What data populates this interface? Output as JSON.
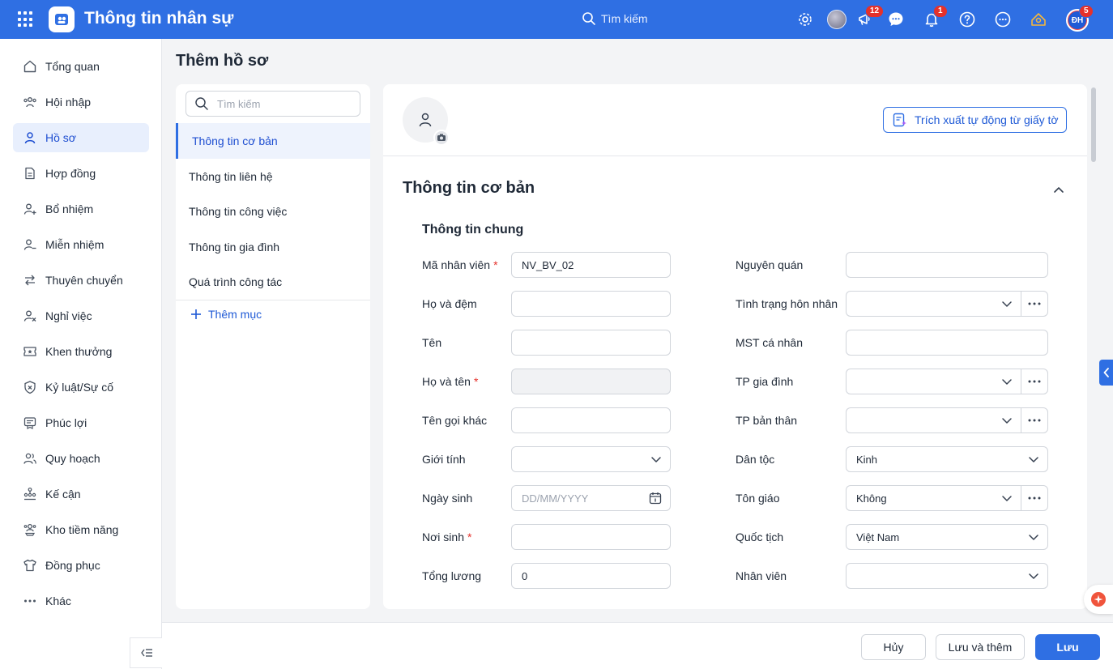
{
  "header": {
    "app_title": "Thông tin nhân sự",
    "search_label": "Tìm kiếm",
    "announcements_badge": "12",
    "notifications_badge": "1",
    "user_initials": "ĐH",
    "user_badge": "5"
  },
  "sidebar": {
    "items": [
      {
        "label": "Tổng quan",
        "icon": "home-icon"
      },
      {
        "label": "Hội nhập",
        "icon": "people-icon"
      },
      {
        "label": "Hồ sơ",
        "icon": "user-icon"
      },
      {
        "label": "Hợp đồng",
        "icon": "document-icon"
      },
      {
        "label": "Bổ nhiệm",
        "icon": "user-plus-icon"
      },
      {
        "label": "Miễn nhiệm",
        "icon": "user-minus-icon"
      },
      {
        "label": "Thuyên chuyển",
        "icon": "transfer-icon"
      },
      {
        "label": "Nghỉ việc",
        "icon": "user-x-icon"
      },
      {
        "label": "Khen thưởng",
        "icon": "ticket-star-icon"
      },
      {
        "label": "Kỷ luật/Sự cố",
        "icon": "shield-x-icon"
      },
      {
        "label": "Phúc lợi",
        "icon": "benefit-icon"
      },
      {
        "label": "Quy hoạch",
        "icon": "users-icon"
      },
      {
        "label": "Kế cận",
        "icon": "hierarchy-icon"
      },
      {
        "label": "Kho tiềm năng",
        "icon": "talent-pool-icon"
      },
      {
        "label": "Đồng phục",
        "icon": "shirt-icon"
      },
      {
        "label": "Khác",
        "icon": "more-icon"
      }
    ],
    "active_index": 2
  },
  "page": {
    "title": "Thêm hồ sơ"
  },
  "sections_panel": {
    "search_placeholder": "Tìm kiếm",
    "items": [
      "Thông tin cơ bản",
      "Thông tin liên hệ",
      "Thông tin công việc",
      "Thông tin gia đình",
      "Quá trình công tác"
    ],
    "active_index": 0,
    "add_label": "Thêm mục"
  },
  "form": {
    "extract_button": "Trích xuất tự động từ giấy tờ",
    "section_title": "Thông tin cơ bản",
    "subsection_title": "Thông tin chung",
    "left_fields": [
      {
        "label": "Mã nhân viên",
        "required": "*",
        "value": "NV_BV_02",
        "type": "text"
      },
      {
        "label": "Họ và đệm",
        "required": "",
        "value": "",
        "type": "text"
      },
      {
        "label": "Tên",
        "required": "",
        "value": "",
        "type": "text"
      },
      {
        "label": "Họ và tên",
        "required": "*",
        "value": "",
        "type": "disabled"
      },
      {
        "label": "Tên gọi khác",
        "required": "",
        "value": "",
        "type": "text"
      },
      {
        "label": "Giới tính",
        "required": "",
        "value": "",
        "type": "select"
      },
      {
        "label": "Ngày sinh",
        "required": "",
        "value": "",
        "placeholder": "DD/MM/YYYY",
        "type": "date"
      },
      {
        "label": "Nơi sinh",
        "required": "*",
        "value": "",
        "type": "text"
      },
      {
        "label": "Tổng lương",
        "required": "",
        "value": "0",
        "type": "text"
      }
    ],
    "right_fields": [
      {
        "label": "Nguyên quán",
        "value": "",
        "type": "text"
      },
      {
        "label": "Tình trạng hôn nhân",
        "value": "",
        "type": "select-more"
      },
      {
        "label": "MST cá nhân",
        "value": "",
        "type": "text"
      },
      {
        "label": "TP gia đình",
        "value": "",
        "type": "select-more"
      },
      {
        "label": "TP bản thân",
        "value": "",
        "type": "select-more"
      },
      {
        "label": "Dân tộc",
        "value": "Kinh",
        "type": "select"
      },
      {
        "label": "Tôn giáo",
        "value": "Không",
        "type": "select-more"
      },
      {
        "label": "Quốc tịch",
        "value": "Việt Nam",
        "type": "select"
      },
      {
        "label": "Nhân viên",
        "value": "",
        "type": "select"
      }
    ]
  },
  "actions": {
    "cancel": "Hủy",
    "save_and_add": "Lưu và thêm",
    "save": "Lưu"
  },
  "colors": {
    "brand": "#2f6fe3",
    "required": "#e5312b",
    "badge": "#e5312b"
  }
}
